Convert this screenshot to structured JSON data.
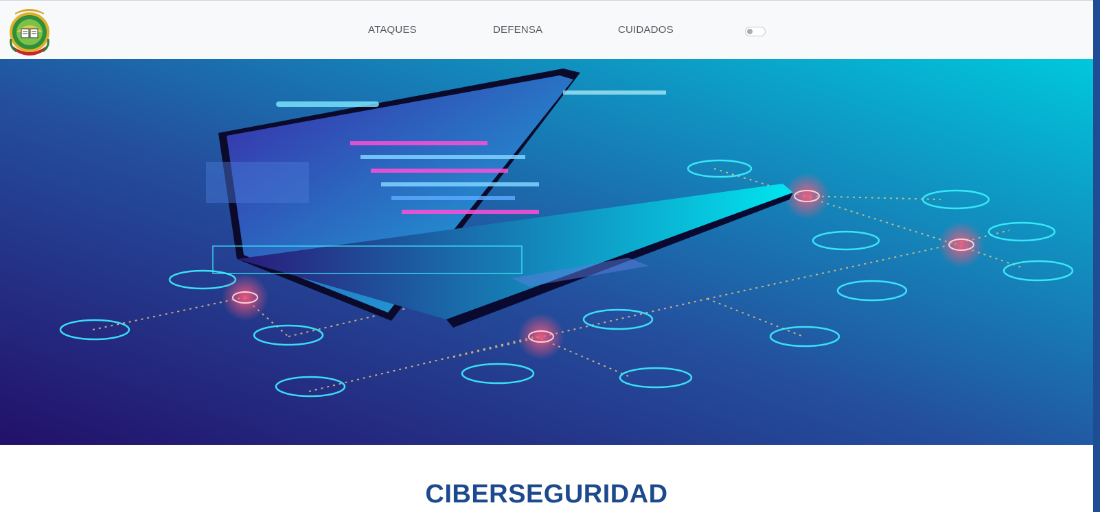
{
  "navbar": {
    "logo_icon": "university-crest-icon",
    "links": [
      {
        "label": "ATAQUES"
      },
      {
        "label": "DEFENSA"
      },
      {
        "label": "CUIDADOS"
      }
    ],
    "theme_toggle": {
      "icon": "toggle-switch-icon",
      "state": "off"
    }
  },
  "hero": {
    "icon": "cybersecurity-laptop-illustration",
    "colors": {
      "dark": "#23106a",
      "mid": "#1f4f9c",
      "light": "#00c8dc"
    }
  },
  "main": {
    "title": "CIBERSEGURIDAD"
  },
  "colors": {
    "accent": "#1d4a8c",
    "navbar_bg": "#f8f9fa",
    "nav_text": "#555b61"
  }
}
